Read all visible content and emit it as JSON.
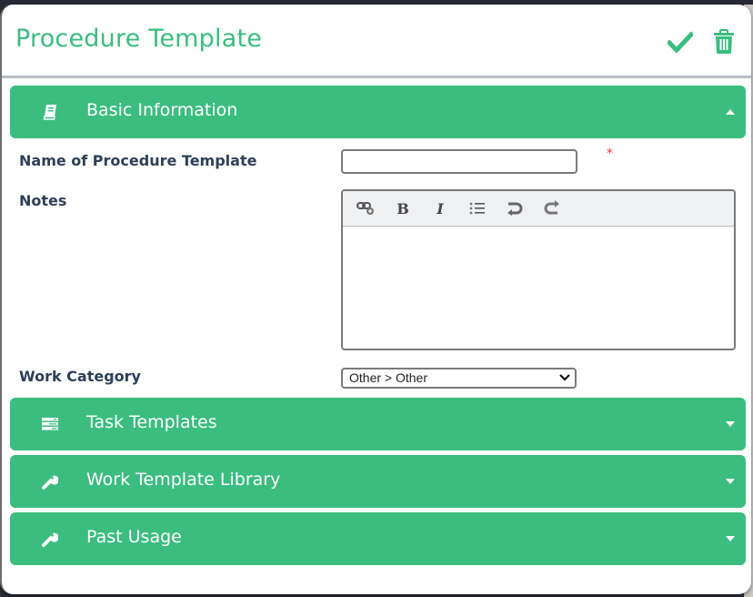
{
  "modal": {
    "title": "Procedure Template",
    "actions": {
      "save_icon": "checkmark-icon",
      "delete_icon": "trash-icon"
    }
  },
  "colors": {
    "accent": "#3bbd7f",
    "label": "#2e3f56",
    "required": "#e0393e"
  },
  "sections": [
    {
      "label": "Basic Information",
      "icon": "book-icon",
      "expanded": true
    },
    {
      "label": "Task Templates",
      "icon": "server-icon",
      "expanded": false
    },
    {
      "label": "Work Template Library",
      "icon": "wrench-icon",
      "expanded": false
    },
    {
      "label": "Past Usage",
      "icon": "wrench-icon",
      "expanded": false
    }
  ],
  "form": {
    "name": {
      "label": "Name of Procedure Template",
      "value": "",
      "required_marker": "*"
    },
    "notes": {
      "label": "Notes",
      "value": "",
      "toolbar": [
        "link-icon",
        "bold-icon",
        "italic-icon",
        "bulleted-list-icon",
        "undo-icon",
        "redo-icon"
      ],
      "bold_glyph": "B",
      "italic_glyph": "I"
    },
    "work_category": {
      "label": "Work Category",
      "selected": "Other > Other"
    }
  }
}
